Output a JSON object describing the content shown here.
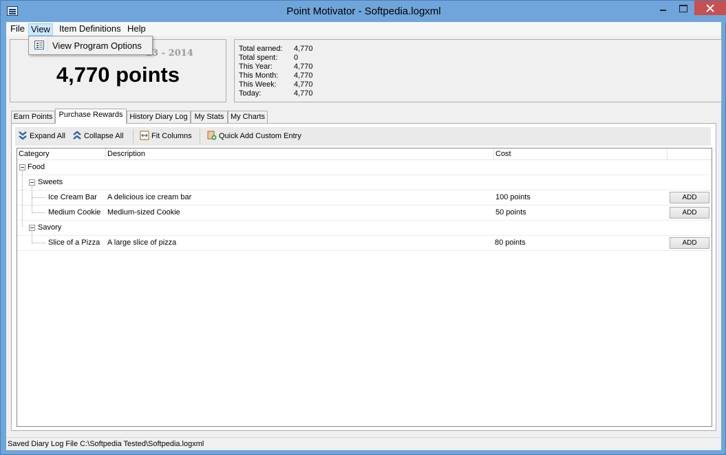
{
  "window": {
    "title": "Point Motivator - Softpedia.logxml"
  },
  "menubar": {
    "file": "File",
    "view": "View",
    "item_definitions": "Item Definitions",
    "help": "Help"
  },
  "view_menu": {
    "items": [
      {
        "label": "View Program Options",
        "icon": "program-options-icon"
      }
    ]
  },
  "points_panel": {
    "date": "Tuesday, July 23 - 2014",
    "date_visible": "23 - 2014",
    "points": "4,770 points"
  },
  "stats": [
    {
      "label": "Total earned:",
      "value": "4,770"
    },
    {
      "label": "Total spent:",
      "value": "0"
    },
    {
      "label": "This Year:",
      "value": "4,770"
    },
    {
      "label": "This Month:",
      "value": "4,770"
    },
    {
      "label": "This Week:",
      "value": "4,770"
    },
    {
      "label": "Today:",
      "value": "4,770"
    }
  ],
  "tabs": [
    {
      "label": "Earn Points"
    },
    {
      "label": "Purchase Rewards",
      "selected": true
    },
    {
      "label": "History Diary Log"
    },
    {
      "label": "My Stats"
    },
    {
      "label": "My Charts"
    }
  ],
  "toolbar": {
    "expand_all": "Expand All",
    "collapse_all": "Collapse All",
    "fit_columns": "Fit Columns",
    "quick_add": "Quick Add Custom Entry"
  },
  "grid": {
    "columns": [
      "Category",
      "Description",
      "Cost",
      ""
    ],
    "groups": {
      "food": "Food",
      "sweets": "Sweets",
      "savory": "Savory"
    },
    "items": [
      {
        "name": "Ice Cream Bar",
        "description": "A delicious ice cream bar",
        "cost": "100 points",
        "action": "ADD"
      },
      {
        "name": "Medium Cookie",
        "description": "Medium-sized Cookie",
        "cost": "50 points",
        "action": "ADD"
      },
      {
        "name": "Slice of a Pizza",
        "description": "A large slice of pizza",
        "cost": "80 points",
        "action": "ADD"
      }
    ]
  },
  "statusbar": {
    "text": "Saved Diary Log File C:\\Softpedia Tested\\Softpedia.logxml"
  },
  "colors": {
    "titlebar": "#6fa5da",
    "close_button": "#c75050",
    "menu_highlight": "#cce8ff"
  }
}
